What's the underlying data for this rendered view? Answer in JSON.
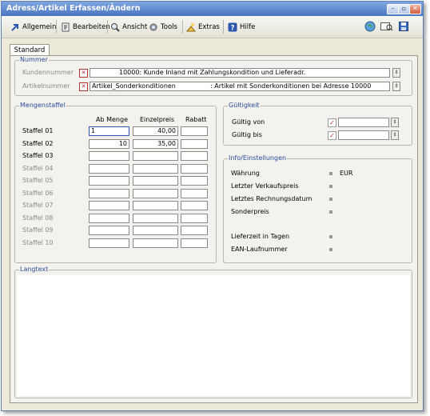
{
  "window": {
    "title": "Adress/Artikel Erfassen/Ändern"
  },
  "toolbar": {
    "allgemein": "Allgemein",
    "bearbeiten": "Bearbeiten",
    "ansicht": "Ansicht",
    "tools": "Tools",
    "extras": "Extras",
    "hilfe": "Hilfe"
  },
  "tab": {
    "label": "Standard"
  },
  "nummer": {
    "legend": "Nummer",
    "kunde_label": "Kundennummer",
    "kunde_value": "10000: Kunde Inland mit Zahlungskondition und Lieferadr.",
    "artikel_label": "Artikelnummer",
    "artikel_code": "Artikel_Sonderkonditionen",
    "artikel_desc": ": Artikel mit Sonderkonditionen bei Adresse 10000"
  },
  "mengenstaffel": {
    "legend": "Mengenstaffel",
    "col_menge": "Ab Menge",
    "col_preis": "Einzelpreis",
    "col_rabatt": "Rabatt",
    "rows": [
      {
        "label": "Staffel 01",
        "menge": "1",
        "preis": "40,00",
        "rabatt": ""
      },
      {
        "label": "Staffel 02",
        "menge": "10",
        "preis": "35,00",
        "rabatt": ""
      },
      {
        "label": "Staffel 03",
        "menge": "",
        "preis": "",
        "rabatt": ""
      },
      {
        "label": "Staffel 04",
        "menge": "",
        "preis": "",
        "rabatt": ""
      },
      {
        "label": "Staffel 05",
        "menge": "",
        "preis": "",
        "rabatt": ""
      },
      {
        "label": "Staffel 06",
        "menge": "",
        "preis": "",
        "rabatt": ""
      },
      {
        "label": "Staffel 07",
        "menge": "",
        "preis": "",
        "rabatt": ""
      },
      {
        "label": "Staffel 08",
        "menge": "",
        "preis": "",
        "rabatt": ""
      },
      {
        "label": "Staffel 09",
        "menge": "",
        "preis": "",
        "rabatt": ""
      },
      {
        "label": "Staffel 10",
        "menge": "",
        "preis": "",
        "rabatt": ""
      }
    ]
  },
  "gueltigkeit": {
    "legend": "Gültigkeit",
    "von_label": "Gültig von",
    "bis_label": "Gültig bis"
  },
  "info": {
    "legend": "Info/Einstellungen",
    "waehrung_label": "Währung",
    "waehrung_value": "EUR",
    "verkauf_label": "Letzter Verkaufspreis",
    "rechnung_label": "Letztes Rechnungsdatum",
    "sonder_label": "Sonderpreis",
    "lieferzeit_label": "Lieferzeit in Tagen",
    "ean_label": "EAN-Laufnummer"
  },
  "langtext": {
    "legend": "Langtext"
  }
}
